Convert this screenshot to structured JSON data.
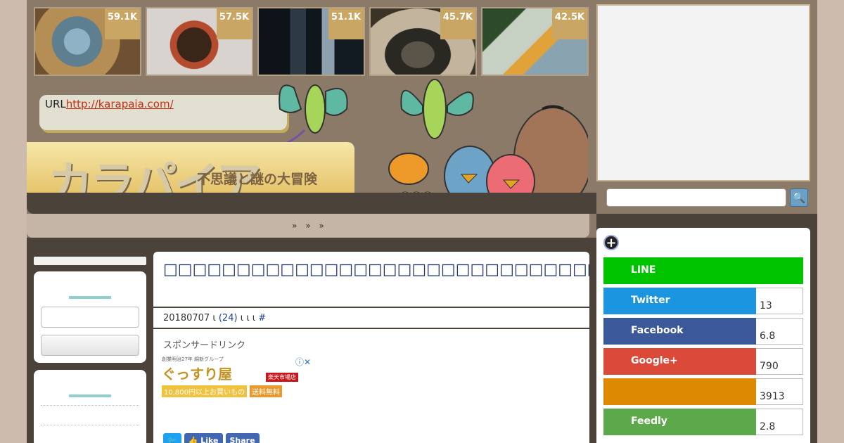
{
  "thumbnails": [
    {
      "count": "59.1K"
    },
    {
      "count": "57.5K"
    },
    {
      "count": "51.1K"
    },
    {
      "count": "45.7K"
    },
    {
      "count": "42.5K"
    }
  ],
  "url_box": {
    "prefix": "URL",
    "link": "http://karapaia.com/"
  },
  "logo": {
    "title": "カラパイア",
    "tagline": "不思議と謎の大冒険"
  },
  "nav": {
    "items": [
      "»",
      "»",
      "»"
    ]
  },
  "article": {
    "title": "□□□□□□□□□□□□□□□□□□□□□□□□□□□□□□□□□□□□□□□□□□□□□□□□",
    "date": "20180707",
    "sep1": "ι",
    "comments": "(24)",
    "sep2": "ι ι ι",
    "hash": "#",
    "sponsor_label": "スポンサードリンク"
  },
  "ad_banner": {
    "small": "創業明治27年 綿新グループ",
    "name": "ぐっすり屋",
    "market": "楽天市場店",
    "deal": "10,800円以上お買いもの",
    "free": "送料無料",
    "close": "ⓘ✕"
  },
  "social_mini": [
    {
      "label": "🐦",
      "color": "#1da1f2"
    },
    {
      "label": "👍 Like",
      "color": "#4267b2"
    },
    {
      "label": "Share",
      "color": "#4267b2"
    }
  ],
  "share": {
    "plus": "+",
    "rows": [
      {
        "label": "LINE",
        "count": "",
        "color": "#00c300",
        "full": true
      },
      {
        "label": "Twitter",
        "count": "13",
        "color": "#1b95e0",
        "full": false
      },
      {
        "label": "Facebook",
        "count": "6.8",
        "color": "#3b5998",
        "full": false
      },
      {
        "label": "Google+",
        "count": "790",
        "color": "#db4a39",
        "full": false
      },
      {
        "label": "",
        "count": "3913",
        "color": "#dd8a00",
        "full": false
      },
      {
        "label": "Feedly",
        "count": "2.8",
        "color": "#6cc655",
        "full": false
      }
    ]
  },
  "search": {
    "button": "🔍"
  }
}
